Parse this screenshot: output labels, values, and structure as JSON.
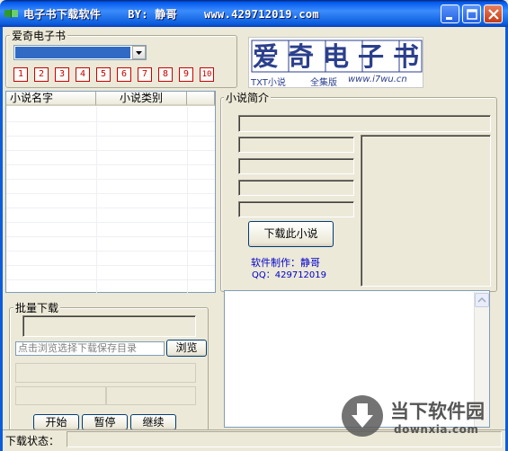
{
  "window": {
    "title": "电子书下载软件    BY: 静哥    www.429712019.com"
  },
  "source_group": {
    "label": "爱奇电子书",
    "selected_value": "",
    "pages": [
      "1",
      "2",
      "3",
      "4",
      "5",
      "6",
      "7",
      "8",
      "9",
      "10"
    ]
  },
  "logo": {
    "main_text": "爱奇电子书",
    "txt_label": "TXT小说",
    "edition": "全集版",
    "url": "www.i7wu.cn"
  },
  "novel_list": {
    "columns": [
      "小说名字",
      "小说类别"
    ],
    "rows": []
  },
  "intro_group": {
    "label": "小说简介",
    "download_button": "下载此小说",
    "author_line": "软件制作：静哥",
    "qq_line": "QQ：429712019"
  },
  "batch_group": {
    "label": "批量下载",
    "path_placeholder": "点击浏览选择下载保存目录",
    "browse_button": "浏览",
    "start_button": "开始",
    "pause_button": "暂停",
    "continue_button": "继续"
  },
  "status_bar": {
    "label": "下载状态：",
    "value": ""
  },
  "watermark": {
    "name": "当下软件园",
    "url": "downxia.com"
  },
  "colors": {
    "titlebar": "#0b5ddd",
    "window_bg": "#ece9d8",
    "number_button": "#cc0000",
    "info_text": "#0000cc",
    "logo_blue": "#2b3f8c",
    "logo_red": "#cc2222"
  }
}
